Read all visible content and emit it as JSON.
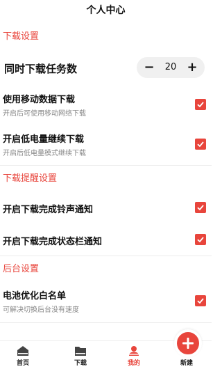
{
  "header": {
    "title": "个人中心"
  },
  "sections": {
    "download": {
      "title": "下载设置"
    },
    "reminder": {
      "title": "下载提醒设置"
    },
    "background": {
      "title": "后台设置"
    }
  },
  "concurrent": {
    "label": "同时下载任务数",
    "value": "20",
    "minus": "−",
    "plus": "+"
  },
  "toggles": {
    "mobile_data": {
      "title": "使用移动数据下载",
      "subtitle": "开启后可使用移动网络下载",
      "checked": true
    },
    "low_power": {
      "title": "开启低电量继续下载",
      "subtitle": "开启后低电量模式继续下载",
      "checked": true
    },
    "ringtone": {
      "title": "开启下载完成铃声通知",
      "checked": true
    },
    "statusbar": {
      "title": "开启下载完成状态栏通知",
      "checked": true
    },
    "battery_whitelist": {
      "title": "电池优化白名单",
      "subtitle": "可解决切换后台没有速度",
      "checked": true
    }
  },
  "tabbar": {
    "home": "首页",
    "download": "下载",
    "mine": "我的",
    "new": "新建"
  },
  "colors": {
    "accent": "#e8453c"
  }
}
